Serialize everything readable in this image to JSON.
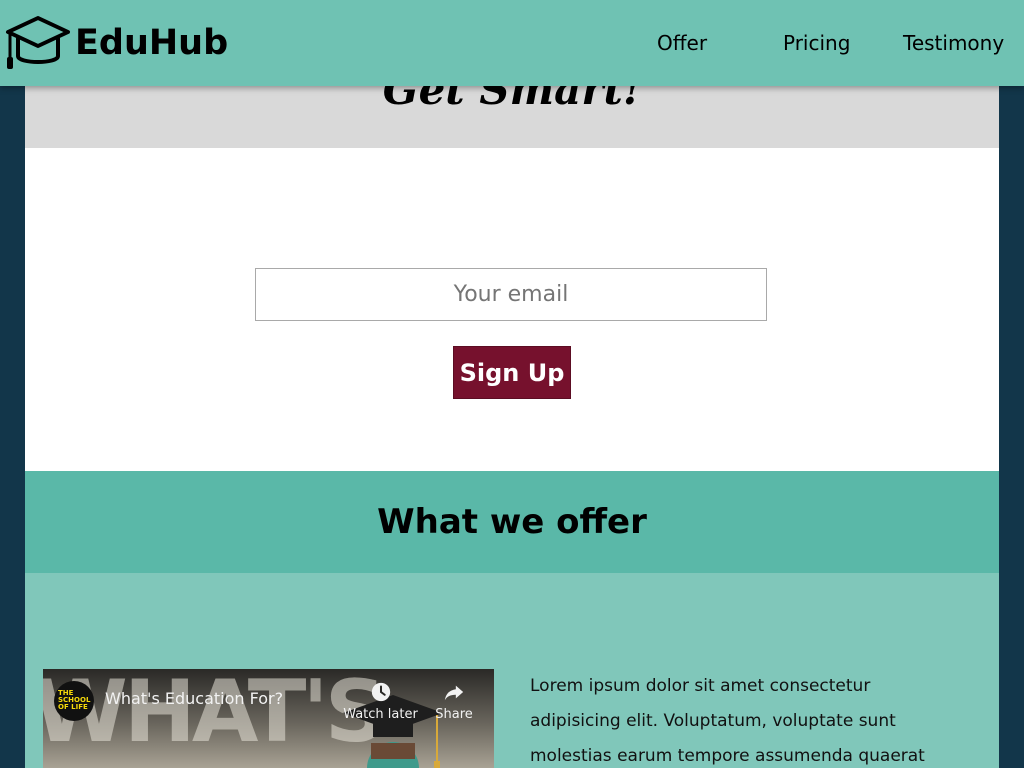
{
  "header": {
    "brand": "EduHub",
    "logo_icon": "graduation-cap-icon",
    "nav": [
      {
        "label": "Offer"
      },
      {
        "label": "Pricing"
      },
      {
        "label": "Testimony"
      }
    ]
  },
  "hero": {
    "title": "Get Smart!"
  },
  "signup": {
    "email_placeholder": "Your email",
    "button_label": "Sign Up"
  },
  "offer": {
    "heading": "What we offer",
    "video": {
      "title": "What's Education For?",
      "channel_logo_text": "THE SCHOOL OF LIFE",
      "background_text": "WHAT'S",
      "watch_later_label": "Watch later",
      "share_label": "Share"
    },
    "text": "Lorem ipsum dolor sit amet consectetur adipisicing elit. Voluptatum, voluptate sunt molestias earum tempore assumenda quaerat"
  },
  "colors": {
    "navbar": "#6fc2b3",
    "page_background": "#12364a",
    "hero_band": "#d9d9d9",
    "signup_button": "#76112d",
    "offer_heading_band": "#5ab8a8",
    "offer_body": "#80c7ba"
  }
}
